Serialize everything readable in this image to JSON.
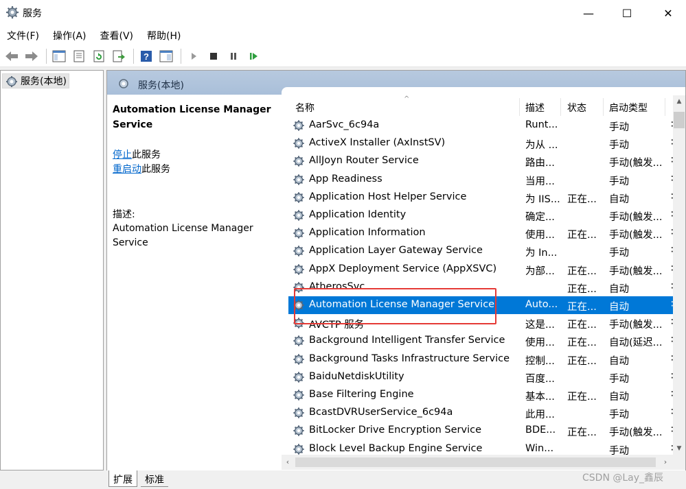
{
  "window": {
    "title": "服务",
    "minimize_glyph": "—",
    "maximize_glyph": "☐",
    "close_glyph": "✕"
  },
  "menu": [
    "文件(F)",
    "操作(A)",
    "查看(V)",
    "帮助(H)"
  ],
  "toolbar_icons": [
    "back-arrow-icon",
    "forward-arrow-icon",
    "console-tree-icon",
    "properties-icon",
    "refresh-icon",
    "export-list-icon",
    "help-icon",
    "panel-icon",
    "start-service-icon",
    "stop-service-icon",
    "pause-service-icon",
    "restart-service-icon"
  ],
  "tree": {
    "root_label": "服务(本地)"
  },
  "pane_header": {
    "title": "服务(本地)"
  },
  "details": {
    "service_name": "Automation License Manager Service",
    "stop_link": "停止",
    "stop_suffix": "此服务",
    "restart_link": "重启动",
    "restart_suffix": "此服务",
    "description_label": "描述:",
    "description_text": "Automation License Manager Service"
  },
  "columns": {
    "name": "名称",
    "description": "描述",
    "status": "状态",
    "startup_type": "启动类型"
  },
  "rows": [
    {
      "name": "AarSvc_6c94a",
      "desc": "Runt...",
      "status": "",
      "startup": "手动"
    },
    {
      "name": "ActiveX Installer (AxInstSV)",
      "desc": "为从 ...",
      "status": "",
      "startup": "手动"
    },
    {
      "name": "AllJoyn Router Service",
      "desc": "路由...",
      "status": "",
      "startup": "手动(触发..."
    },
    {
      "name": "App Readiness",
      "desc": "当用...",
      "status": "",
      "startup": "手动"
    },
    {
      "name": "Application Host Helper Service",
      "desc": "为 IIS...",
      "status": "正在...",
      "startup": "自动"
    },
    {
      "name": "Application Identity",
      "desc": "确定...",
      "status": "",
      "startup": "手动(触发..."
    },
    {
      "name": "Application Information",
      "desc": "使用...",
      "status": "正在...",
      "startup": "手动(触发..."
    },
    {
      "name": "Application Layer Gateway Service",
      "desc": "为 In...",
      "status": "",
      "startup": "手动"
    },
    {
      "name": "AppX Deployment Service (AppXSVC)",
      "desc": "为部...",
      "status": "正在...",
      "startup": "手动(触发..."
    },
    {
      "name": "AtherosSvc",
      "desc": "",
      "status": "正在...",
      "startup": "自动"
    },
    {
      "name": "Automation License Manager Service",
      "desc": "Auto...",
      "status": "正在...",
      "startup": "自动"
    },
    {
      "name": "AVCTP 服务",
      "desc": "这是...",
      "status": "正在...",
      "startup": "手动(触发..."
    },
    {
      "name": "Background Intelligent Transfer Service",
      "desc": "使用...",
      "status": "正在...",
      "startup": "自动(延迟..."
    },
    {
      "name": "Background Tasks Infrastructure Service",
      "desc": "控制...",
      "status": "正在...",
      "startup": "自动"
    },
    {
      "name": "BaiduNetdiskUtility",
      "desc": "百度...",
      "status": "",
      "startup": "手动"
    },
    {
      "name": "Base Filtering Engine",
      "desc": "基本...",
      "status": "正在...",
      "startup": "自动"
    },
    {
      "name": "BcastDVRUserService_6c94a",
      "desc": "此用...",
      "status": "",
      "startup": "手动"
    },
    {
      "name": "BitLocker Drive Encryption Service",
      "desc": "BDE...",
      "status": "正在...",
      "startup": "手动(触发..."
    },
    {
      "name": "Block Level Backup Engine Service",
      "desc": "Win...",
      "status": "",
      "startup": "手动"
    }
  ],
  "row_overflow_glyph": "∶",
  "selected_row": "Automation License Manager Service",
  "tabs": [
    "扩展",
    "标准"
  ],
  "watermark": "CSDN @Lay_鑫辰",
  "colors": {
    "selection": "#0078d7",
    "header_band": "#aec3dc",
    "link": "#0066cc",
    "annotation_box": "#e53935"
  }
}
